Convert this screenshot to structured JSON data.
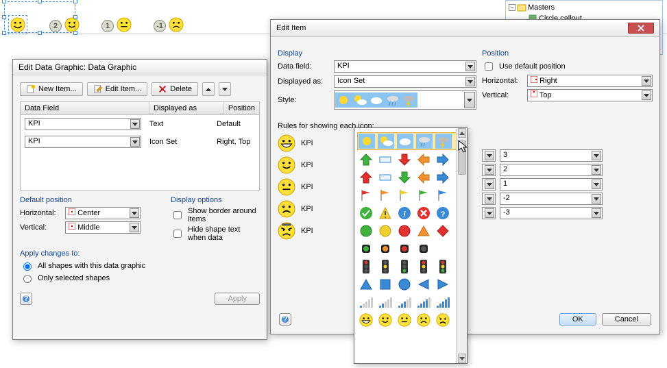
{
  "canvas": {
    "labels": [
      "2",
      "1",
      "-1"
    ]
  },
  "side_tree": {
    "masters": "Masters",
    "item1": "Circle callout"
  },
  "edg": {
    "title": "Edit Data Graphic: Data Graphic",
    "new_item": "New Item...",
    "edit_item": "Edit Item...",
    "delete": "Delete",
    "col_field": "Data Field",
    "col_disp": "Displayed as",
    "col_pos": "Position",
    "rows": [
      {
        "field": "KPI",
        "disp": "Text",
        "pos": "Default"
      },
      {
        "field": "KPI",
        "disp": "Icon Set",
        "pos": "Right, Top"
      }
    ],
    "def_pos": "Default position",
    "horiz": "Horizontal:",
    "horiz_val": "Center",
    "vert": "Vertical:",
    "vert_val": "Middle",
    "disp_opts": "Display options",
    "cb1": "Show border around items",
    "cb2": "Hide shape text when data",
    "apply_to": "Apply changes to:",
    "r1": "All shapes with this data graphic",
    "r2": "Only selected shapes",
    "apply": "Apply"
  },
  "ei": {
    "title": "Edit Item",
    "display": "Display",
    "data_field": "Data field:",
    "data_field_val": "KPI",
    "disp_as": "Displayed as:",
    "disp_as_val": "Icon Set",
    "style": "Style:",
    "rules": "Rules for showing each icon:",
    "rule_label": "KPI",
    "position": "Position",
    "use_default": "Use default position",
    "horiz": "Horizontal:",
    "horiz_val": "Right",
    "vert": "Vertical:",
    "vert_val": "Top",
    "vals": [
      "3",
      "2",
      "1",
      "-2",
      "-3"
    ],
    "ok": "OK",
    "cancel": "Cancel"
  }
}
